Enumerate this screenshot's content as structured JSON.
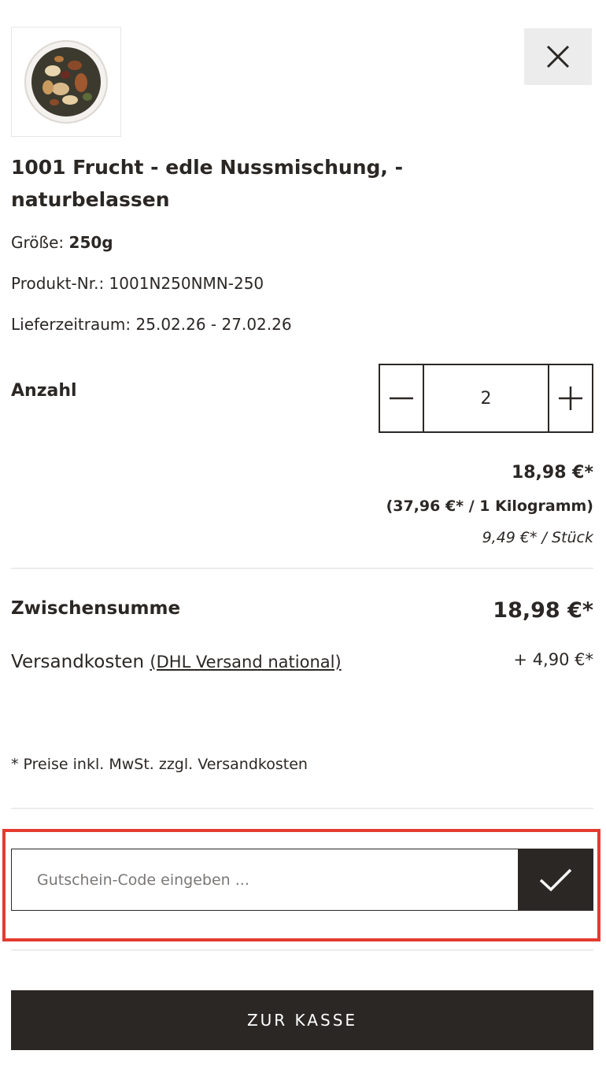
{
  "product": {
    "image_alt": "nut-mix-bowl",
    "title": "1001 Frucht - edle Nussmischung, - naturbelassen",
    "size_label": "Größe:",
    "size_value": "250g",
    "sku_label": "Produkt-Nr.:",
    "sku_value": "1001N250NMN-250",
    "delivery_label": "Lieferzeitraum:",
    "delivery_value": "25.02.26 - 27.02.26"
  },
  "quantity": {
    "label": "Anzahl",
    "value": "2"
  },
  "pricing": {
    "total": "18,98 €*",
    "per_unit": "(37,96 €* / 1 Kilogramm)",
    "per_piece": "9,49 €* / Stück"
  },
  "summary": {
    "subtotal_label": "Zwischensumme",
    "subtotal_value": "18,98 €*",
    "shipping_label": "Versandkosten",
    "shipping_link": "(DHL Versand national)",
    "shipping_value": "+ 4,90 €*",
    "note": "* Preise inkl. MwSt. zzgl. Versandkosten"
  },
  "voucher": {
    "placeholder": "Gutschein-Code eingeben ..."
  },
  "checkout": {
    "label": "ZUR KASSE"
  },
  "colors": {
    "primary_dark": "#2b2725",
    "highlight": "#e43b30",
    "close_bg": "#ececec"
  },
  "icons": {
    "close": "close-icon",
    "minus": "minus-icon",
    "plus": "plus-icon",
    "check": "checkmark-icon"
  }
}
